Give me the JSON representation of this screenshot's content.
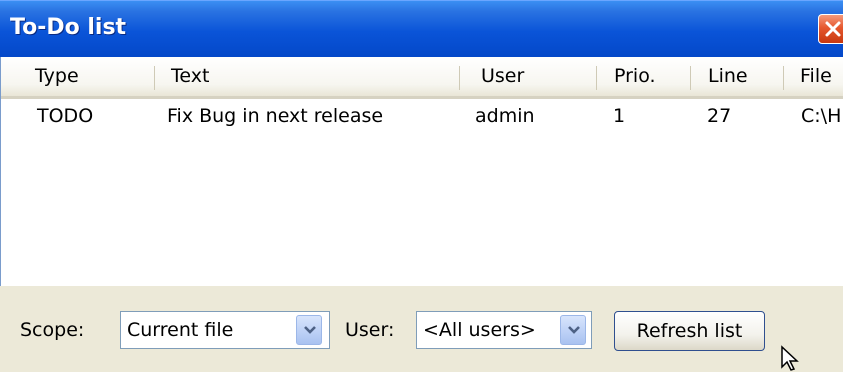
{
  "window": {
    "title": "To-Do list"
  },
  "list": {
    "columns": [
      "Type",
      "Text",
      "User",
      "Prio.",
      "Line",
      "File"
    ],
    "rows": [
      [
        "TODO",
        "Fix Bug in next release",
        "admin",
        "1",
        "27",
        "C:\\H"
      ]
    ]
  },
  "toolbar": {
    "scope_label": "Scope:",
    "scope_value": "Current file",
    "user_label": "User:",
    "user_value": "<All users>",
    "refresh_label": "Refresh list"
  },
  "icons": {
    "close": "close-icon",
    "scroll_left": "arrow-left-icon",
    "scroll_right": "arrow-right-icon",
    "dropdown": "chevron-down-icon",
    "cursor": "mouse-pointer-icon"
  },
  "colors": {
    "titlebar": "#0a54d8",
    "close_button": "#e6582e",
    "window_bg": "#ece9d8",
    "scroll_accent": "#c0d3f7"
  }
}
